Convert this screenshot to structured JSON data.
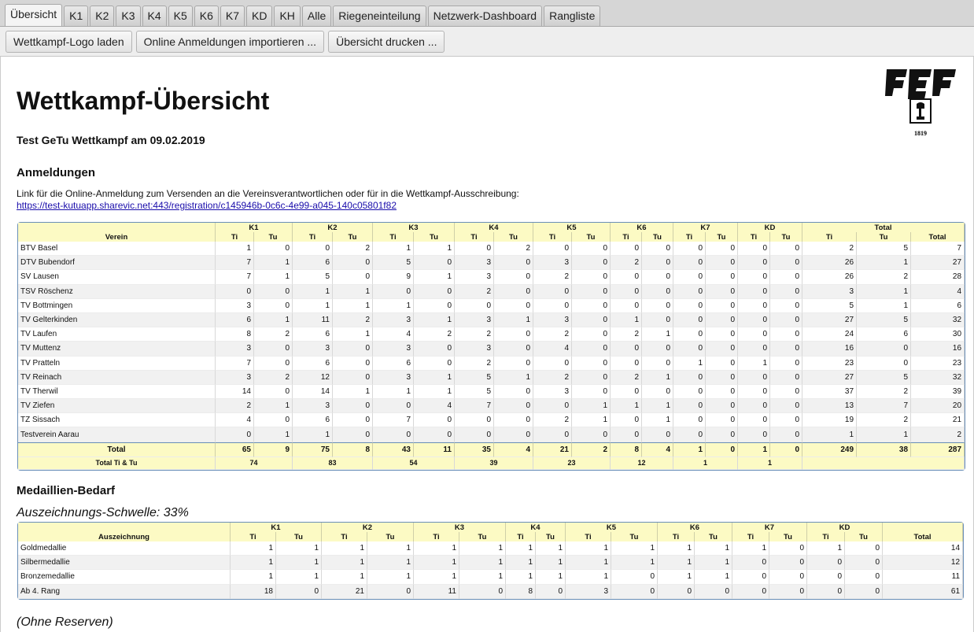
{
  "tabs": [
    "Übersicht",
    "K1",
    "K2",
    "K3",
    "K4",
    "K5",
    "K6",
    "K7",
    "KD",
    "KH",
    "Alle",
    "Riegeneinteilung",
    "Netzwerk-Dashboard",
    "Rangliste"
  ],
  "active_tab": 0,
  "toolbar": {
    "buttons": [
      "Wettkampf-Logo laden",
      "Online Anmeldungen importieren ...",
      "Übersicht drucken ..."
    ]
  },
  "page": {
    "title": "Wettkampf-Übersicht",
    "subtitle": "Test GeTu Wettkampf am 09.02.2019",
    "logo_year": "1819",
    "section_anmeldungen": "Anmeldungen",
    "registration_text": "Link für die Online-Anmeldung zum Versenden an die Vereinsverantwortlichen oder für in die Wettkampf-Ausschreibung:",
    "registration_link": "https://test-kutuapp.sharevic.net:443/registration/c145946b-0c6c-4e99-a045-140c05801f82",
    "section_medaillen": "Medaillien-Bedarf",
    "threshold": "Auszeichnungs-Schwelle: 33%",
    "no_reserve": "(Ohne Reserven)"
  },
  "registrations": {
    "header_verein": "Verein",
    "categories": [
      "K1",
      "K2",
      "K3",
      "K4",
      "K5",
      "K6",
      "K7",
      "KD"
    ],
    "header_total": "Total",
    "sub_ti": "Ti",
    "sub_tu": "Tu",
    "rows": [
      {
        "name": "BTV Basel",
        "v": [
          1,
          0,
          0,
          2,
          1,
          1,
          0,
          2,
          0,
          0,
          0,
          0,
          0,
          0,
          0,
          0,
          2,
          5,
          7
        ]
      },
      {
        "name": "DTV Bubendorf",
        "v": [
          7,
          1,
          6,
          0,
          5,
          0,
          3,
          0,
          3,
          0,
          2,
          0,
          0,
          0,
          0,
          0,
          26,
          1,
          27
        ]
      },
      {
        "name": "SV Lausen",
        "v": [
          7,
          1,
          5,
          0,
          9,
          1,
          3,
          0,
          2,
          0,
          0,
          0,
          0,
          0,
          0,
          0,
          26,
          2,
          28
        ]
      },
      {
        "name": "TSV Röschenz",
        "v": [
          0,
          0,
          1,
          1,
          0,
          0,
          2,
          0,
          0,
          0,
          0,
          0,
          0,
          0,
          0,
          0,
          3,
          1,
          4
        ]
      },
      {
        "name": "TV Bottmingen",
        "v": [
          3,
          0,
          1,
          1,
          1,
          0,
          0,
          0,
          0,
          0,
          0,
          0,
          0,
          0,
          0,
          0,
          5,
          1,
          6
        ]
      },
      {
        "name": "TV Gelterkinden",
        "v": [
          6,
          1,
          11,
          2,
          3,
          1,
          3,
          1,
          3,
          0,
          1,
          0,
          0,
          0,
          0,
          0,
          27,
          5,
          32
        ]
      },
      {
        "name": "TV Laufen",
        "v": [
          8,
          2,
          6,
          1,
          4,
          2,
          2,
          0,
          2,
          0,
          2,
          1,
          0,
          0,
          0,
          0,
          24,
          6,
          30
        ]
      },
      {
        "name": "TV Muttenz",
        "v": [
          3,
          0,
          3,
          0,
          3,
          0,
          3,
          0,
          4,
          0,
          0,
          0,
          0,
          0,
          0,
          0,
          16,
          0,
          16
        ]
      },
      {
        "name": "TV Pratteln",
        "v": [
          7,
          0,
          6,
          0,
          6,
          0,
          2,
          0,
          0,
          0,
          0,
          0,
          1,
          0,
          1,
          0,
          23,
          0,
          23
        ]
      },
      {
        "name": "TV Reinach",
        "v": [
          3,
          2,
          12,
          0,
          3,
          1,
          5,
          1,
          2,
          0,
          2,
          1,
          0,
          0,
          0,
          0,
          27,
          5,
          32
        ]
      },
      {
        "name": "TV Therwil",
        "v": [
          14,
          0,
          14,
          1,
          1,
          1,
          5,
          0,
          3,
          0,
          0,
          0,
          0,
          0,
          0,
          0,
          37,
          2,
          39
        ]
      },
      {
        "name": "TV Ziefen",
        "v": [
          2,
          1,
          3,
          0,
          0,
          4,
          7,
          0,
          0,
          1,
          1,
          1,
          0,
          0,
          0,
          0,
          13,
          7,
          20
        ]
      },
      {
        "name": "TZ Sissach",
        "v": [
          4,
          0,
          6,
          0,
          7,
          0,
          0,
          0,
          2,
          1,
          0,
          1,
          0,
          0,
          0,
          0,
          19,
          2,
          21
        ]
      },
      {
        "name": "Testverein Aarau",
        "v": [
          0,
          1,
          1,
          0,
          0,
          0,
          0,
          0,
          0,
          0,
          0,
          0,
          0,
          0,
          0,
          0,
          1,
          1,
          2
        ]
      }
    ],
    "total_label": "Total",
    "totals": [
      65,
      9,
      75,
      8,
      43,
      11,
      35,
      4,
      21,
      2,
      8,
      4,
      1,
      0,
      1,
      0,
      249,
      38,
      287
    ],
    "total_titu_label": "Total Ti & Tu",
    "totals_titu": [
      74,
      83,
      54,
      39,
      23,
      12,
      1,
      1
    ]
  },
  "medals": {
    "header_label": "Auszeichnung",
    "categories": [
      "K1",
      "K2",
      "K3",
      "K4",
      "K5",
      "K6",
      "K7",
      "KD"
    ],
    "header_total": "Total",
    "sub_ti": "Ti",
    "sub_tu": "Tu",
    "rows": [
      {
        "name": "Goldmedallie",
        "v": [
          1,
          1,
          1,
          1,
          1,
          1,
          1,
          1,
          1,
          1,
          1,
          1,
          1,
          0,
          1,
          0,
          14
        ]
      },
      {
        "name": "Silbermedallie",
        "v": [
          1,
          1,
          1,
          1,
          1,
          1,
          1,
          1,
          1,
          1,
          1,
          1,
          0,
          0,
          0,
          0,
          12
        ]
      },
      {
        "name": "Bronzemedallie",
        "v": [
          1,
          1,
          1,
          1,
          1,
          1,
          1,
          1,
          1,
          0,
          1,
          1,
          0,
          0,
          0,
          0,
          11
        ]
      },
      {
        "name": "Ab 4. Rang",
        "v": [
          18,
          0,
          21,
          0,
          11,
          0,
          8,
          0,
          3,
          0,
          0,
          0,
          0,
          0,
          0,
          0,
          61
        ]
      }
    ]
  }
}
